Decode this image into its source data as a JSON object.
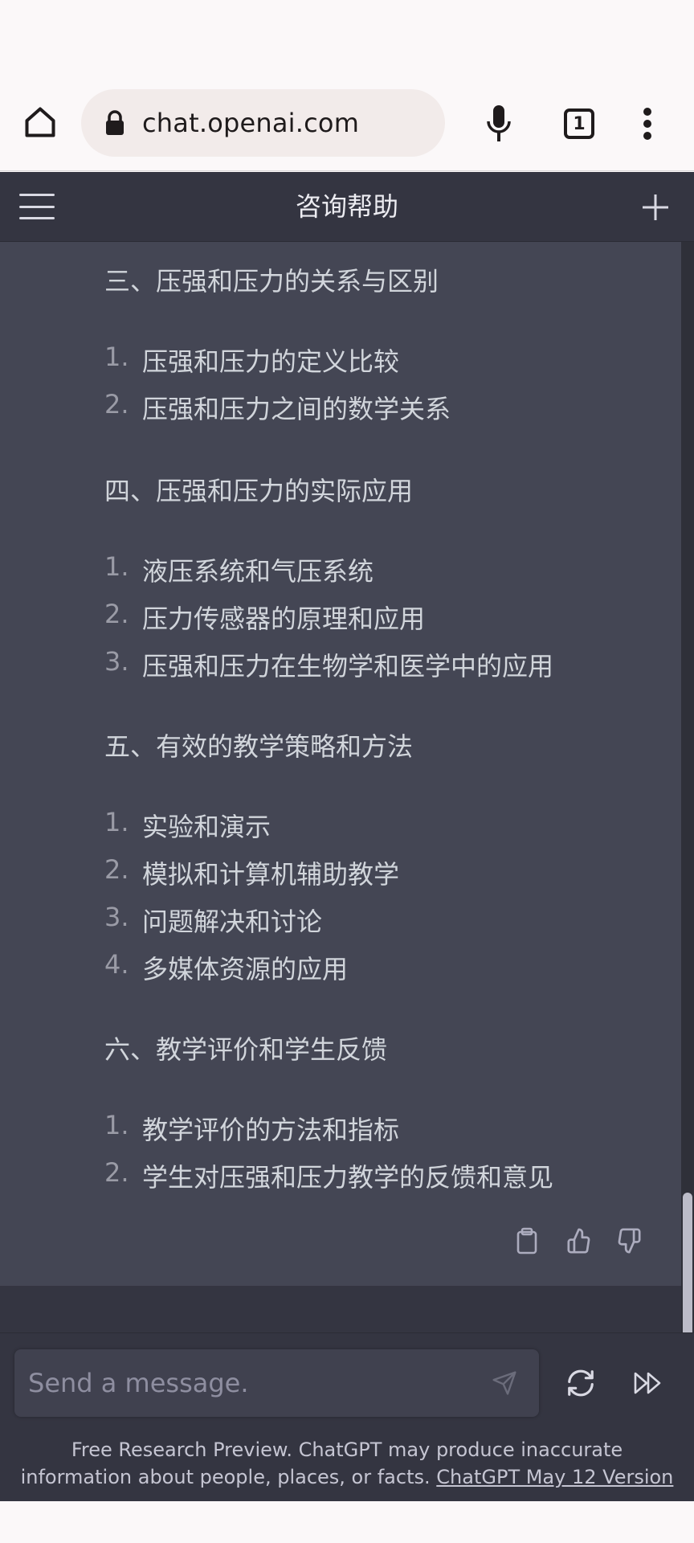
{
  "browser": {
    "url": "chat.openai.com",
    "tab_count": "1",
    "icons": [
      "home-icon",
      "lock-icon",
      "microphone-icon",
      "tabs-icon",
      "more-vert-icon"
    ]
  },
  "app": {
    "title": "咨询帮助",
    "icons": [
      "hamburger-menu-icon",
      "plus-icon"
    ]
  },
  "message": {
    "sections": [
      {
        "title": "三、压强和压力的关系与区别",
        "items": [
          {
            "num": "1.",
            "text": "压强和压力的定义比较"
          },
          {
            "num": "2.",
            "text": "压强和压力之间的数学关系"
          }
        ]
      },
      {
        "title": "四、压强和压力的实际应用",
        "items": [
          {
            "num": "1.",
            "text": "液压系统和气压系统"
          },
          {
            "num": "2.",
            "text": "压力传感器的原理和应用"
          },
          {
            "num": "3.",
            "text": "压强和压力在生物学和医学中的应用"
          }
        ]
      },
      {
        "title": "五、有效的教学策略和方法",
        "items": [
          {
            "num": "1.",
            "text": "实验和演示"
          },
          {
            "num": "2.",
            "text": "模拟和计算机辅助教学"
          },
          {
            "num": "3.",
            "text": "问题解决和讨论"
          },
          {
            "num": "4.",
            "text": "多媒体资源的应用"
          }
        ]
      },
      {
        "title": "六、教学评价和学生反馈",
        "items": [
          {
            "num": "1.",
            "text": "教学评价的方法和指标"
          },
          {
            "num": "2.",
            "text": "学生对压强和压力教学的反馈和意见"
          }
        ]
      }
    ],
    "action_icons": [
      "clipboard-icon",
      "thumbs-up-icon",
      "thumbs-down-icon"
    ]
  },
  "composer": {
    "placeholder": "Send a message.",
    "icons": [
      "send-icon",
      "regenerate-icon",
      "continue-icon"
    ],
    "footer_text": "Free Research Preview. ChatGPT may produce inaccurate information about people, places, or facts.",
    "footer_link": "ChatGPT May 12 Version"
  },
  "colors": {
    "browser_bg": "#fbf8f9",
    "url_pill_bg": "#f2ebea",
    "header_bg": "#343541",
    "message_bg": "#444654",
    "input_bg": "#40414f",
    "text_primary": "#d1d5db",
    "text_muted": "#8e8ea0"
  }
}
